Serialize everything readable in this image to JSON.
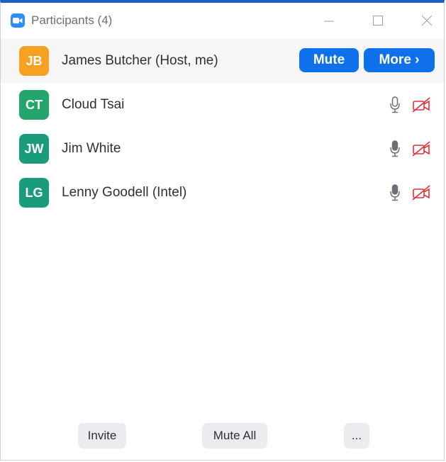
{
  "window": {
    "title": "Participants (4)",
    "minimize_icon": "minimize-icon",
    "maximize_icon": "maximize-icon",
    "close_icon": "close-icon"
  },
  "host": {
    "initials": "JB",
    "name": "James Butcher (Host, me)",
    "avatar_color": "#f7a122",
    "mute_label": "Mute",
    "more_label": "More ›"
  },
  "participants": [
    {
      "initials": "CT",
      "name": "Cloud Tsai",
      "avatar_color": "#23a56b",
      "mic": "mic-outline-icon",
      "video": "video-off-icon"
    },
    {
      "initials": "JW",
      "name": "Jim White",
      "avatar_color": "#1a9b7b",
      "mic": "mic-filled-icon",
      "video": "video-off-icon"
    },
    {
      "initials": "LG",
      "name": "Lenny Goodell (Intel)",
      "avatar_color": "#1a9b7b",
      "mic": "mic-filled-icon",
      "video": "video-off-icon"
    }
  ],
  "footer": {
    "invite_label": "Invite",
    "mute_all_label": "Mute All",
    "more_label": "..."
  },
  "colors": {
    "accent": "#0e71eb",
    "title_border": "#1f5fbf",
    "video_off": "#e0313b"
  }
}
